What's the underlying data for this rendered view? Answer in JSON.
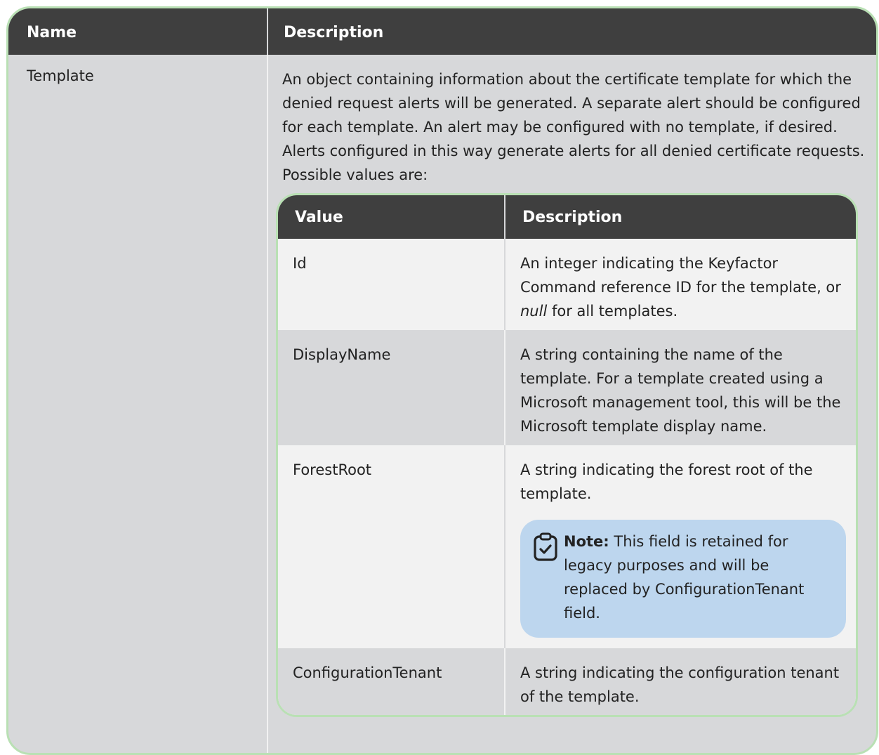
{
  "outer": {
    "headers": {
      "name": "Name",
      "description": "Description"
    },
    "row": {
      "name": "Template",
      "description": "An object containing information about the certificate template for which the denied request alerts will be generated. A separate alert should be configured for each template. An alert may be configured with no template, if desired. Alerts configured in this way generate alerts for all denied certificate requests.  Possible values are:"
    }
  },
  "inner": {
    "headers": {
      "value": "Value",
      "description": "Description"
    },
    "rows": [
      {
        "value": "Id",
        "desc_before": "An integer indicating the Keyfactor Command reference ID for the template, or ",
        "desc_italic": "null",
        "desc_after": " for all templates."
      },
      {
        "value": "DisplayName",
        "description": "A string containing the name of the template. For a template created using a Microsoft management tool, this will be the Microsoft template display name."
      },
      {
        "value": "ForestRoot",
        "description": "A string indicating the forest root of the template.",
        "note": {
          "label": "Note:",
          "text": "This field is retained for legacy purposes and will be replaced by ConfigurationTenant field.",
          "icon": "clipboard-check-icon"
        }
      },
      {
        "value": "ConfigurationTenant",
        "description": "A string indicating the configuration tenant of the template."
      }
    ]
  },
  "colors": {
    "header_bg": "#3f3f3f",
    "border": "#b9e0b4",
    "gray_row": "#d7d8da",
    "light_row": "#f2f2f2",
    "note_bg": "#bdd6ee"
  }
}
